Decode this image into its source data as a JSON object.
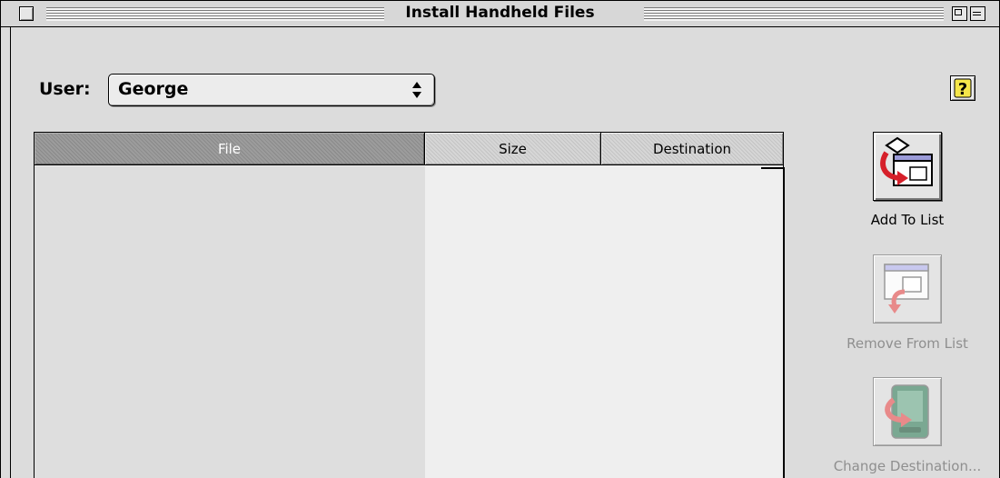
{
  "window": {
    "title": "Install Handheld Files"
  },
  "user_selector": {
    "label": "User:",
    "value": "George"
  },
  "help_button": {
    "symbol": "?"
  },
  "file_list": {
    "columns": [
      "File",
      "Size",
      "Destination"
    ],
    "rows": []
  },
  "actions": [
    {
      "label": "Add To List",
      "icon": "add-to-list-icon",
      "enabled": true
    },
    {
      "label": "Remove From List",
      "icon": "remove-from-list-icon",
      "enabled": false
    },
    {
      "label": "Change Destination...",
      "icon": "change-destination-icon",
      "enabled": false
    }
  ],
  "colors": {
    "accent_red": "#d6202a",
    "disabled_red": "#e88a8a",
    "window_bg": "#dcdcdc"
  }
}
